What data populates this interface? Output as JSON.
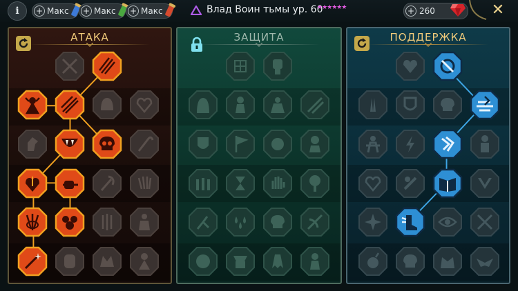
{
  "topbar": {
    "info_label": "i",
    "resources": [
      {
        "label": "Макс",
        "icon": "blue-scroll-icon"
      },
      {
        "label": "Макс",
        "icon": "green-scroll-icon"
      },
      {
        "label": "Макс",
        "icon": "red-scroll-icon"
      }
    ],
    "hero_name": "Влад Воин тьмы ур. 60",
    "hero_stars": "★★★★★★",
    "gems_count": "260",
    "close_label": "✕"
  },
  "panels": {
    "attack": {
      "title": "АТАКА"
    },
    "defense": {
      "title": "ЗАЩИТА"
    },
    "support": {
      "title": "ПОДДЕРЖКА"
    }
  },
  "colors": {
    "attack_accent": "#e8541c",
    "attack_gold": "#f0a020",
    "support_accent": "#3ea6e6",
    "locked": "#4a4a4a",
    "title_gold": "#f0ca7a"
  }
}
